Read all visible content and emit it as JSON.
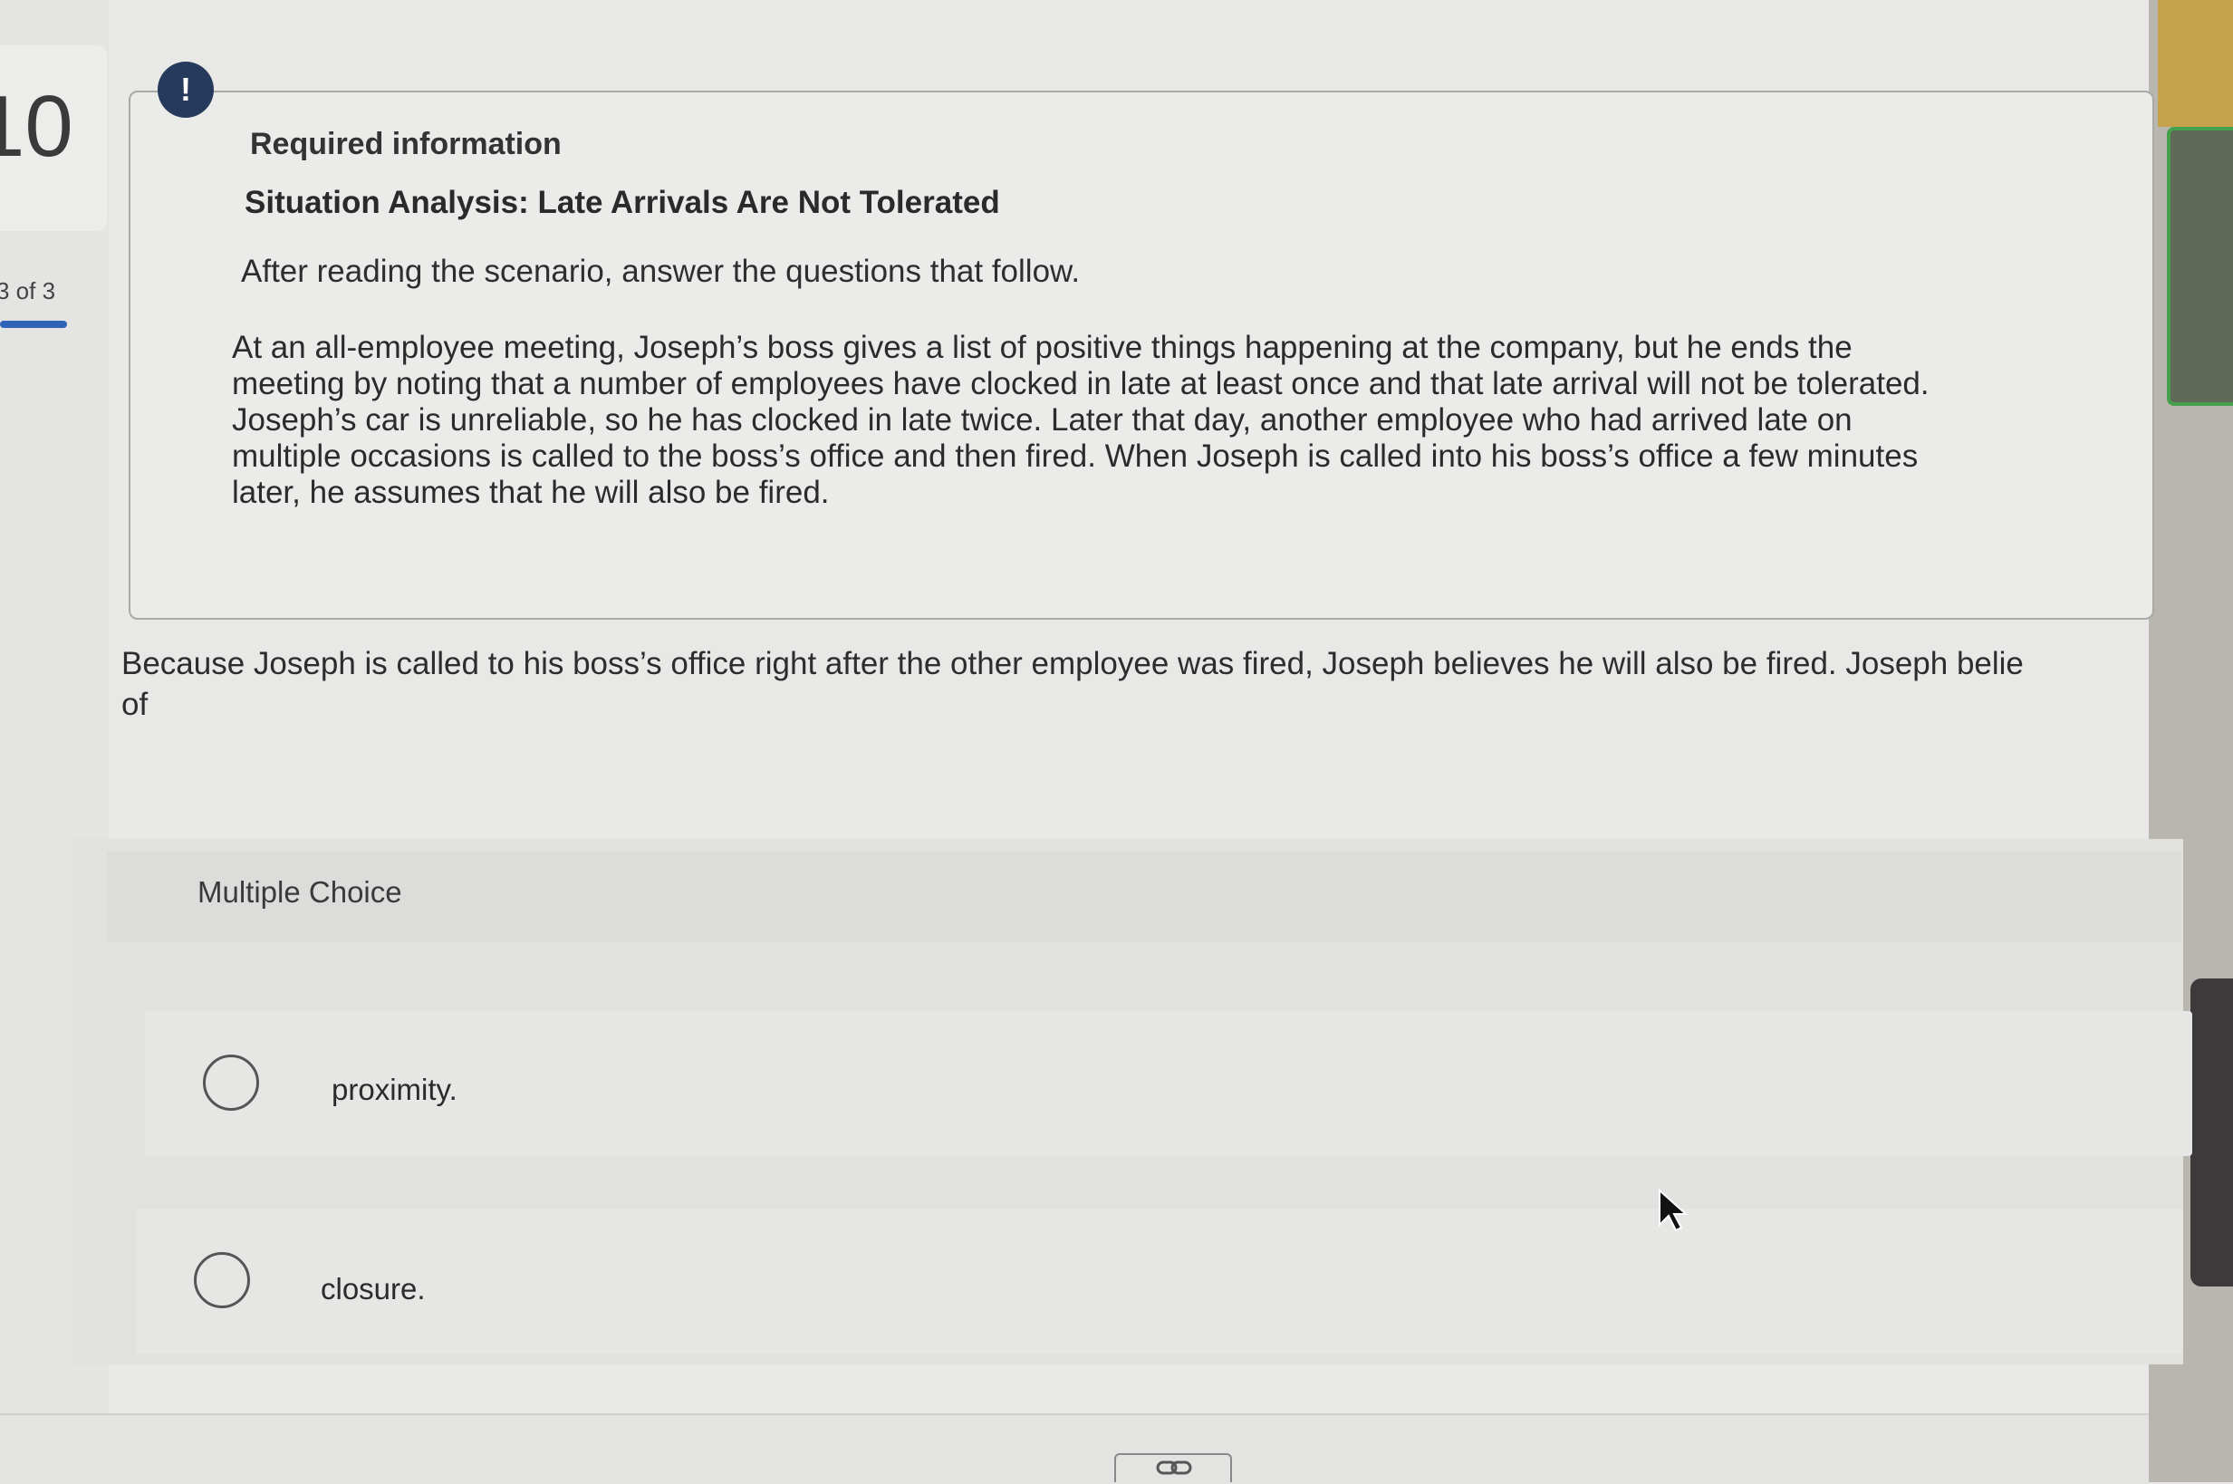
{
  "question_nav": {
    "number": "10",
    "progress_label": "3 of 3",
    "progress_fraction": 1.0
  },
  "info_card": {
    "badge_symbol": "!",
    "heading": "Required information",
    "title": "Situation Analysis: Late Arrivals Are Not Tolerated",
    "instruction": "After reading the scenario, answer the questions that follow.",
    "scenario": "At an all-employee meeting, Joseph’s boss gives a list of positive things happening at the company, but he ends the meeting by noting that a number of employees have clocked in late at least once and that late arrival will not be tolerated. Joseph’s car is unreliable, so he has clocked in late twice. Later that day, another employee who had arrived late on multiple occasions is called to the boss’s office and then fired. When Joseph is called into his boss’s office a few minutes later, he assumes that he will also be fired."
  },
  "question": {
    "text": "Because Joseph is called to his boss’s office right after the other employee was fired, Joseph believes he will also be fired. Joseph belie",
    "continuation": "of"
  },
  "multiple_choice": {
    "label": "Multiple Choice",
    "options": [
      {
        "label": "proximity.",
        "selected": false
      },
      {
        "label": "closure.",
        "selected": false
      }
    ]
  },
  "icons": {
    "info_badge": "exclamation-icon",
    "bottom_link": "link-icon",
    "pointer": "cursor-icon"
  },
  "colors": {
    "badge_bg": "#263b5c",
    "progress_bar": "#2f63b8",
    "page_bg": "#e8e8e6"
  }
}
